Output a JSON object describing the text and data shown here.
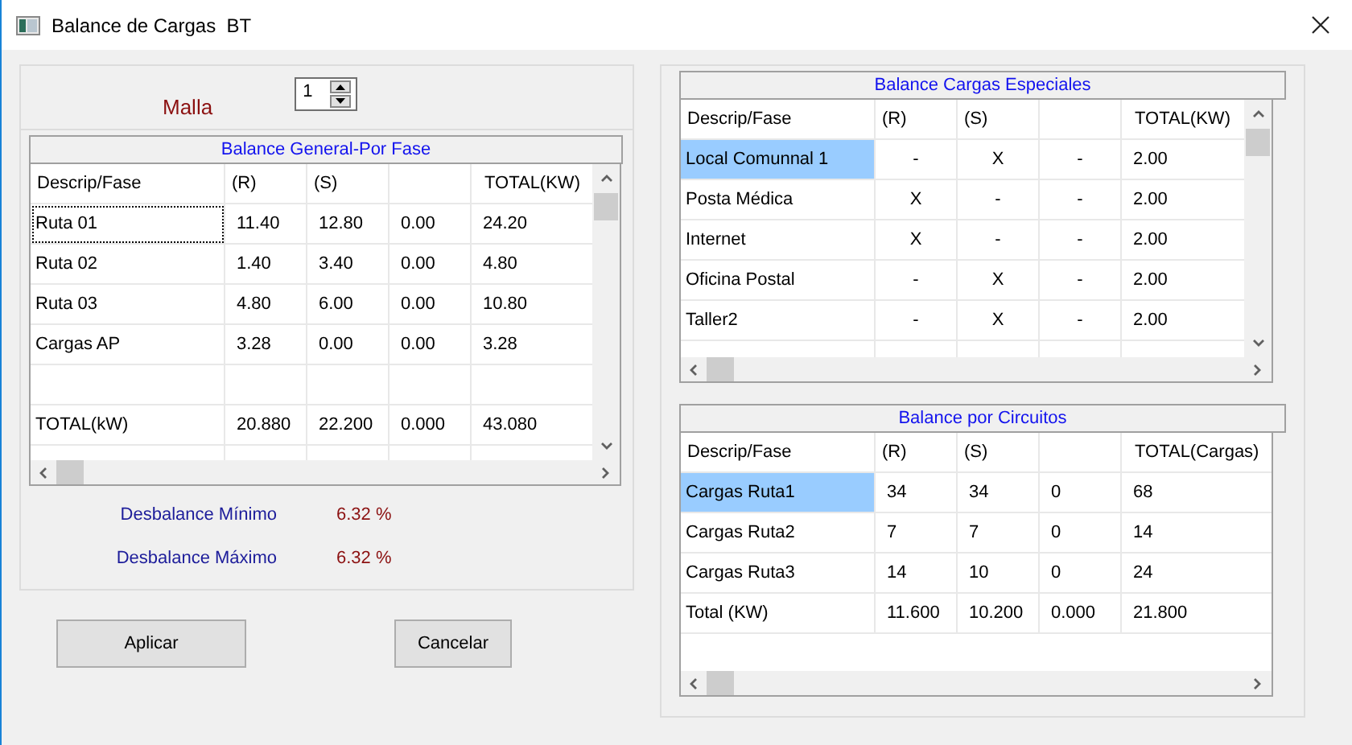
{
  "window": {
    "title": "Balance de Cargas  BT"
  },
  "malla": {
    "label": "Malla",
    "value": "1"
  },
  "general": {
    "title": "Balance General-Por Fase",
    "vertical_scrollbar": true,
    "columns": [
      "Descrip/Fase",
      "(R)",
      "(S)",
      "",
      "TOTAL(KW)"
    ],
    "rows": [
      {
        "kind": "data",
        "focused": true,
        "cells": [
          "Ruta 01",
          "11.40",
          "12.80",
          "0.00",
          "24.20"
        ]
      },
      {
        "kind": "data",
        "focused": false,
        "cells": [
          "Ruta 02",
          "1.40",
          "3.40",
          "0.00",
          "4.80"
        ]
      },
      {
        "kind": "data",
        "focused": false,
        "cells": [
          "Ruta 03",
          "4.80",
          "6.00",
          "0.00",
          "10.80"
        ]
      },
      {
        "kind": "data",
        "focused": false,
        "cells": [
          "Cargas AP",
          "3.28",
          "0.00",
          "0.00",
          "3.28"
        ]
      },
      {
        "kind": "blank",
        "focused": false,
        "cells": []
      },
      {
        "kind": "data",
        "focused": false,
        "cells": [
          "TOTAL(kW)",
          "20.880",
          "22.200",
          "0.000",
          "43.080"
        ]
      },
      {
        "kind": "blank",
        "focused": false,
        "cells": []
      }
    ]
  },
  "imbalance": [
    {
      "label": "Desbalance Mínimo",
      "value": "6.32 %"
    },
    {
      "label": "Desbalance Máximo",
      "value": "6.32 %"
    }
  ],
  "buttons": [
    "Aplicar",
    "Cancelar"
  ],
  "special": {
    "title": "Balance Cargas Especiales",
    "vertical_scrollbar": true,
    "columns": [
      "Descrip/Fase",
      "(R)",
      "(S)",
      "",
      "TOTAL(KW)"
    ],
    "rows": [
      {
        "kind": "data",
        "selected": true,
        "cells": [
          "Local Comunnal 1",
          "-",
          "X",
          "-",
          "2.00"
        ]
      },
      {
        "kind": "data",
        "selected": false,
        "cells": [
          "Posta Médica",
          "X",
          "-",
          "-",
          "2.00"
        ]
      },
      {
        "kind": "data",
        "selected": false,
        "cells": [
          "Internet",
          "X",
          "-",
          "-",
          "2.00"
        ]
      },
      {
        "kind": "data",
        "selected": false,
        "cells": [
          "Oficina Postal",
          "-",
          "X",
          "-",
          "2.00"
        ]
      },
      {
        "kind": "data",
        "selected": false,
        "cells": [
          "Taller2",
          "-",
          "X",
          "-",
          "2.00"
        ]
      },
      {
        "kind": "blank",
        "selected": false,
        "cells": []
      }
    ]
  },
  "circuits": {
    "title": "Balance por Circuitos",
    "vertical_scrollbar": false,
    "columns": [
      "Descrip/Fase",
      "(R)",
      "(S)",
      "",
      "TOTAL(Cargas)"
    ],
    "rows": [
      {
        "kind": "data",
        "selected": true,
        "cells": [
          "Cargas Ruta1",
          "34",
          "34",
          "0",
          "68"
        ]
      },
      {
        "kind": "data",
        "selected": false,
        "cells": [
          "Cargas Ruta2",
          "7",
          "7",
          "0",
          "14"
        ]
      },
      {
        "kind": "data",
        "selected": false,
        "cells": [
          "Cargas Ruta3",
          "14",
          "10",
          "0",
          "24"
        ]
      },
      {
        "kind": "data",
        "selected": false,
        "cells": [
          "Total (KW)",
          "11.600",
          "10.200",
          "0.000",
          "21.800"
        ]
      }
    ]
  }
}
